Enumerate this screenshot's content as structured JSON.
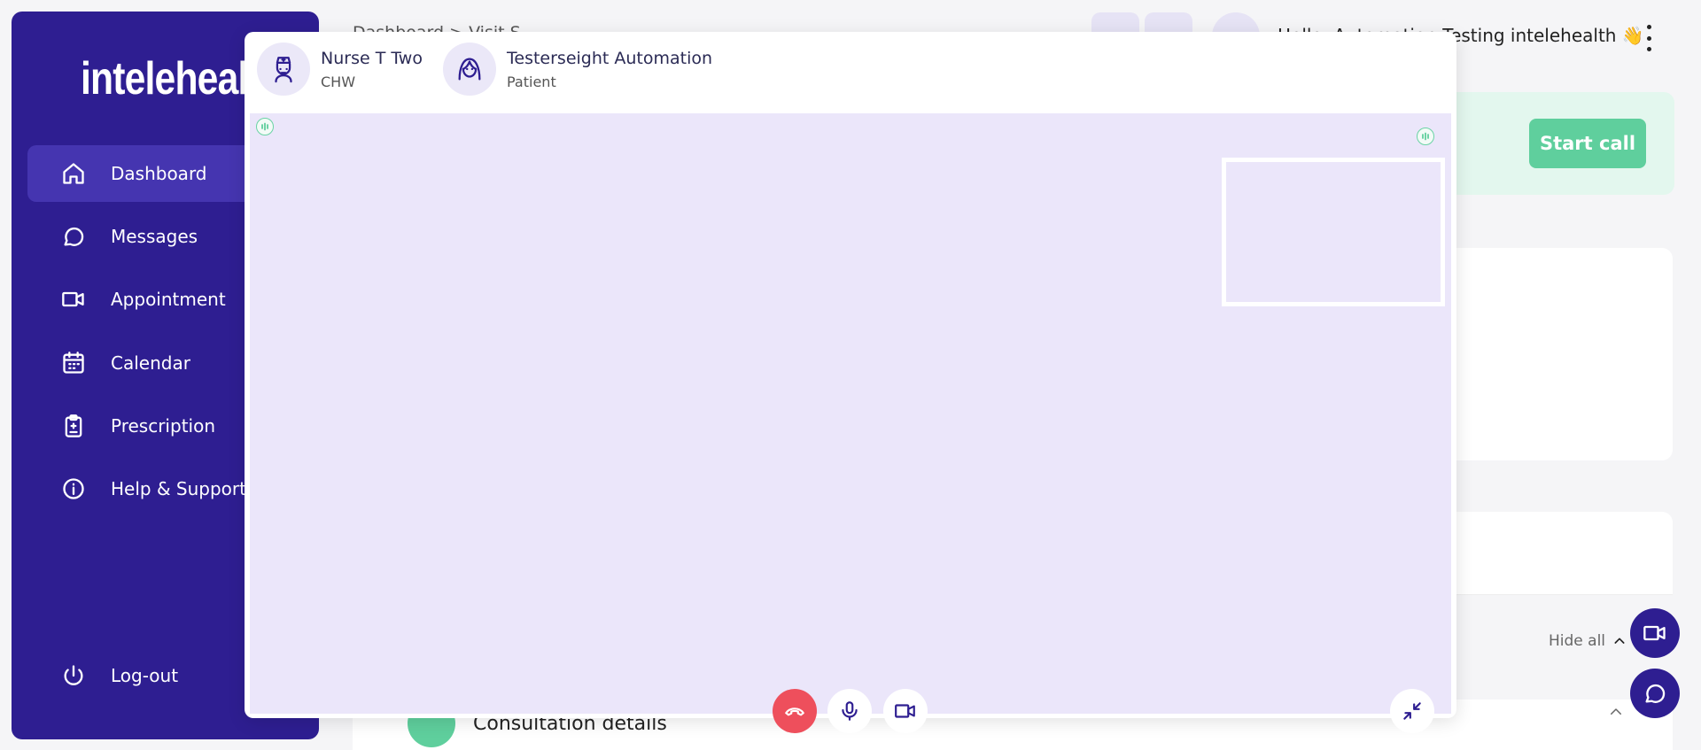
{
  "app": {
    "logo_text": "intelehealth"
  },
  "sidebar": {
    "items": [
      {
        "label": "Dashboard",
        "icon": "home-icon",
        "active": true
      },
      {
        "label": "Messages",
        "icon": "chat-icon"
      },
      {
        "label": "Appointment",
        "icon": "video-icon"
      },
      {
        "label": "Calendar",
        "icon": "calendar-icon"
      },
      {
        "label": "Prescription",
        "icon": "clipboard-icon"
      },
      {
        "label": "Help & Support",
        "icon": "info-icon"
      }
    ],
    "logout_label": "Log-out"
  },
  "header": {
    "breadcrumb": "Dashboard > Visit S",
    "greeting": "Hello, Automation Testing intelehealth 👋"
  },
  "background": {
    "start_call_label": "Start call",
    "hide_all_label": "Hide all",
    "consultation_label": "Consultation details"
  },
  "video_call": {
    "participants": [
      {
        "name": "Nurse T Two",
        "role": "CHW",
        "icon": "nurse-icon"
      },
      {
        "name": "Testerseight Automation",
        "role": "Patient",
        "icon": "patient-icon"
      }
    ],
    "controls": [
      "end-call",
      "microphone",
      "camera",
      "minimize"
    ]
  },
  "colors": {
    "brand": "#2e1e91",
    "brand_active": "#4535b0",
    "video_bg": "#ebe6fa",
    "end_call": "#ee4f5c",
    "success": "#5fcf9d"
  }
}
